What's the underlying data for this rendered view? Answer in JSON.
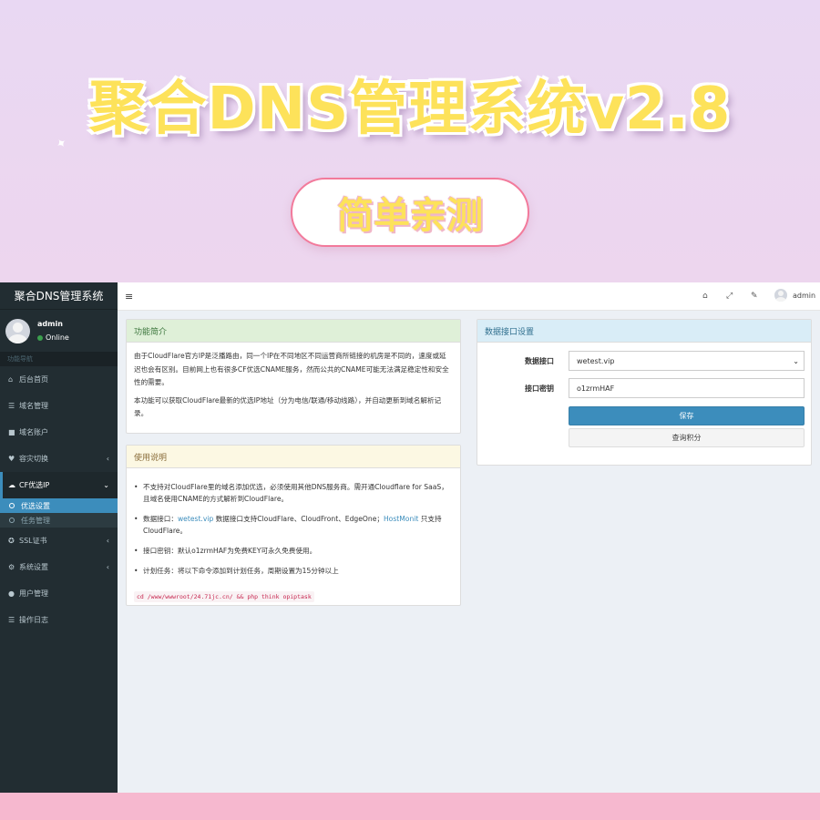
{
  "banner": {
    "title": "聚合DNS管理系统v2.8",
    "pill": "简单亲测"
  },
  "sidebar": {
    "logo": "聚合DNS管理系统",
    "user_name": "admin",
    "user_status": "Online",
    "nav_header": "功能导航",
    "items": [
      {
        "icon": "home-icon",
        "label": "后台首页"
      },
      {
        "icon": "list-icon",
        "label": "域名管理"
      },
      {
        "icon": "lock-icon",
        "label": "域名账户"
      },
      {
        "icon": "heartbeat-icon",
        "label": "容灾切换"
      },
      {
        "icon": "cloud-icon",
        "label": "CF优选IP"
      },
      {
        "icon": "certificate-icon",
        "label": "SSL证书"
      },
      {
        "icon": "cogs-icon",
        "label": "系统设置"
      },
      {
        "icon": "user-icon",
        "label": "用户管理"
      },
      {
        "icon": "list-icon",
        "label": "操作日志"
      }
    ],
    "sub_items": [
      {
        "label": "优选设置"
      },
      {
        "label": "任务管理"
      }
    ]
  },
  "topbar": {
    "user": "admin",
    "icons": [
      "home-icon",
      "expand-icon",
      "wrench-icon"
    ]
  },
  "intro": {
    "title": "功能简介",
    "para1": "由于CloudFlare官方IP是泛播路由，同一个IP在不同地区不同运营商所链接的机房是不同的，速度或延迟也会有区别。目前网上也有很多CF优选CNAME服务，然而公共的CNAME可能无法满足稳定性和安全性的需要。",
    "para2": "本功能可以获取CloudFlare最新的优选IP地址（分为电信/联通/移动线路），并自动更新到域名解析记录。"
  },
  "usage": {
    "title": "使用说明",
    "item1": "不支持对CloudFlare里的域名添加优选，必须使用其他DNS服务商。需开通Cloudflare for SaaS，且域名使用CNAME的方式解析到CloudFlare。",
    "item2_prefix": "数据接口：",
    "item2_link1": "wetest.vip",
    "item2_mid": " 数据接口支持CloudFlare、CloudFront、EdgeOne；",
    "item2_link2": "HostMonit",
    "item2_suffix": " 只支持CloudFlare。",
    "item3": "接口密钥：默认o1zrmHAF为免费KEY可永久免费使用。",
    "item4": "计划任务：将以下命令添加到计划任务，周期设置为15分钟以上",
    "command": "cd /www/wwwroot/24.71jc.cn/ && php think opiptask"
  },
  "settings": {
    "title": "数据接口设置",
    "api_label": "数据接口",
    "api_value": "wetest.vip",
    "key_label": "接口密钥",
    "key_value": "o1zrmHAF",
    "save_label": "保存",
    "query_label": "查询积分"
  }
}
